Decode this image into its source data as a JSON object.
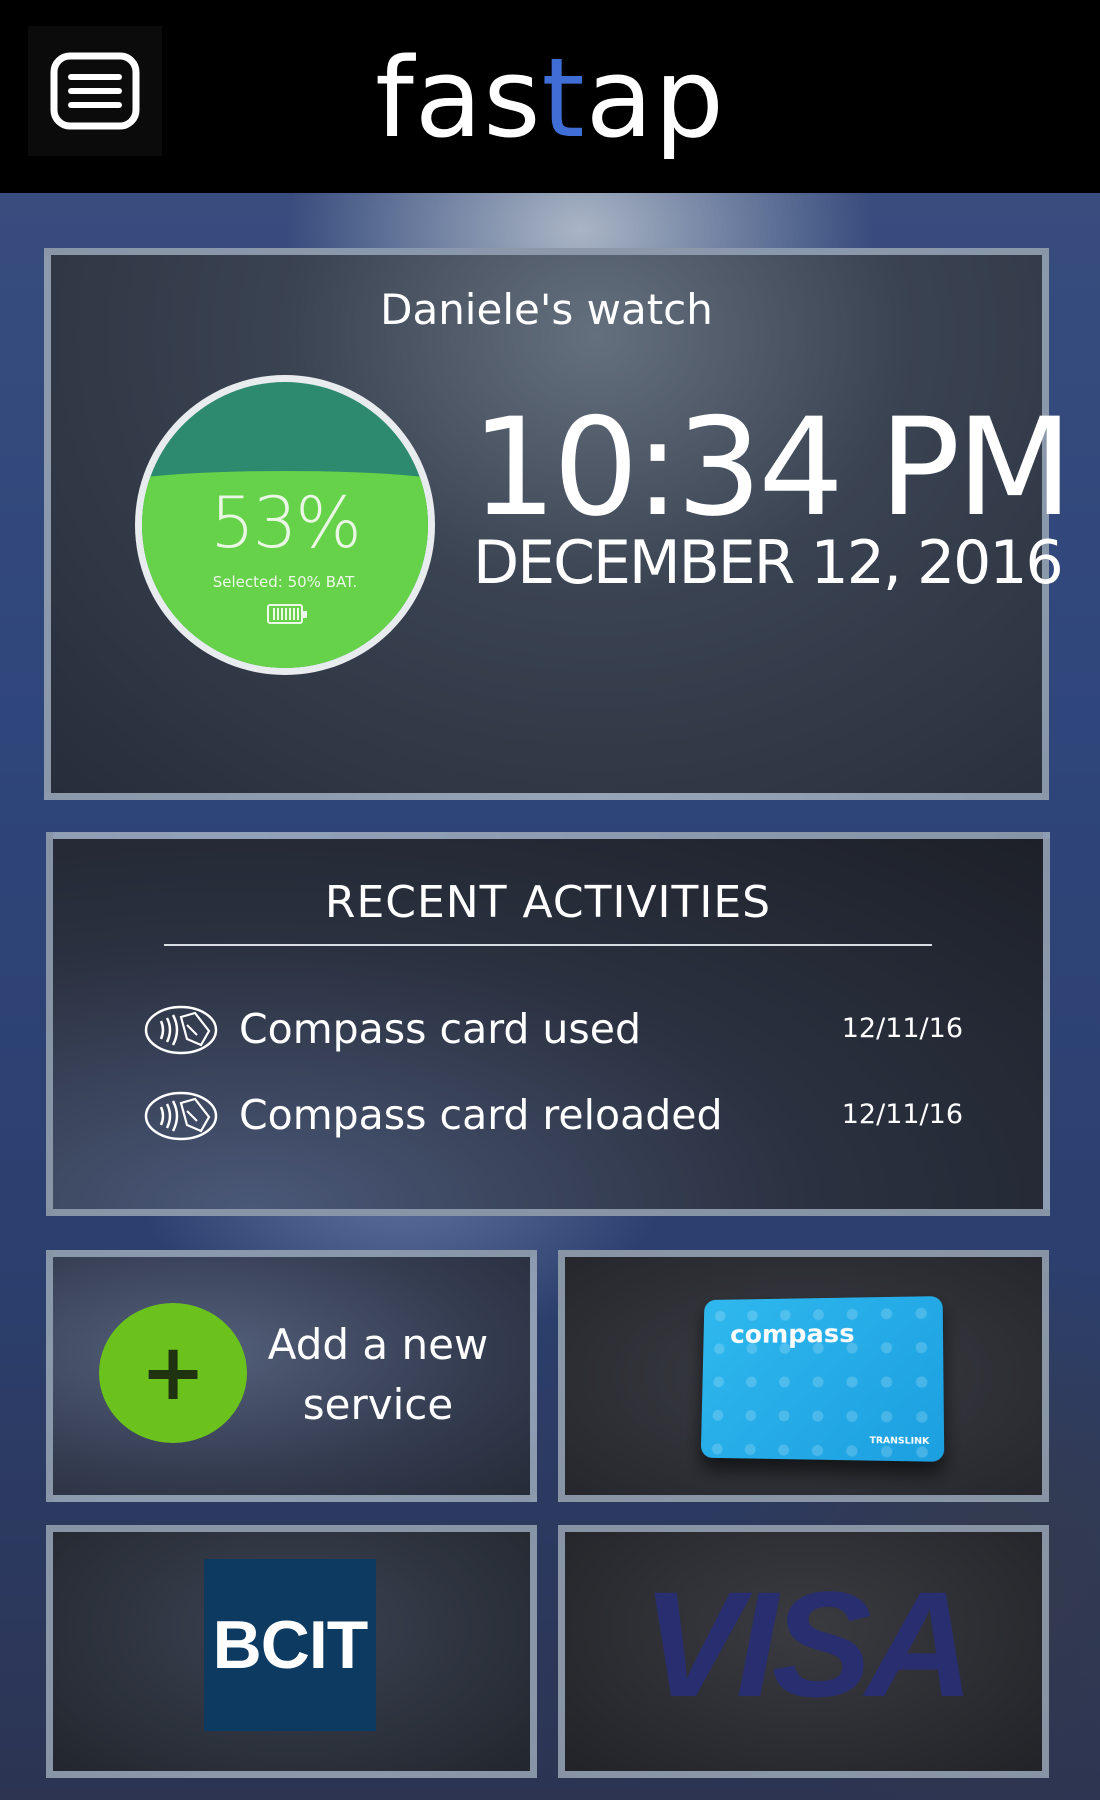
{
  "header": {
    "app_name_prefix": "fas",
    "app_name_accent": "t",
    "app_name_suffix": "ap",
    "menu_icon": "hamburger-menu-icon"
  },
  "watch": {
    "device_name": "Daniele's watch",
    "battery_percent": 53,
    "battery_label": "53%",
    "battery_selected": "Selected: 50% BAT.",
    "time": "10:34 PM",
    "date": "DECEMBER 12, 2016"
  },
  "recent": {
    "title": "RECENT ACTIVITIES",
    "items": [
      {
        "label": "Compass card used",
        "date": "12/11/16",
        "icon": "nfc-tap-icon"
      },
      {
        "label": "Compass card reloaded",
        "date": "12/11/16",
        "icon": "nfc-tap-icon"
      }
    ]
  },
  "tiles": {
    "add": {
      "line1": "Add a new",
      "line2": "service",
      "icon": "plus-icon"
    },
    "compass": {
      "logo": "compass",
      "sub": "TRANSLINK"
    },
    "bcit": {
      "label": "BCIT"
    },
    "visa": {
      "label": "VISA"
    }
  },
  "colors": {
    "accent": "#3f6fd6",
    "battery_green": "#66d24a",
    "plus_green": "#6cc21c",
    "bcit_blue": "#0d3a61",
    "visa_navy": "#282e70"
  }
}
